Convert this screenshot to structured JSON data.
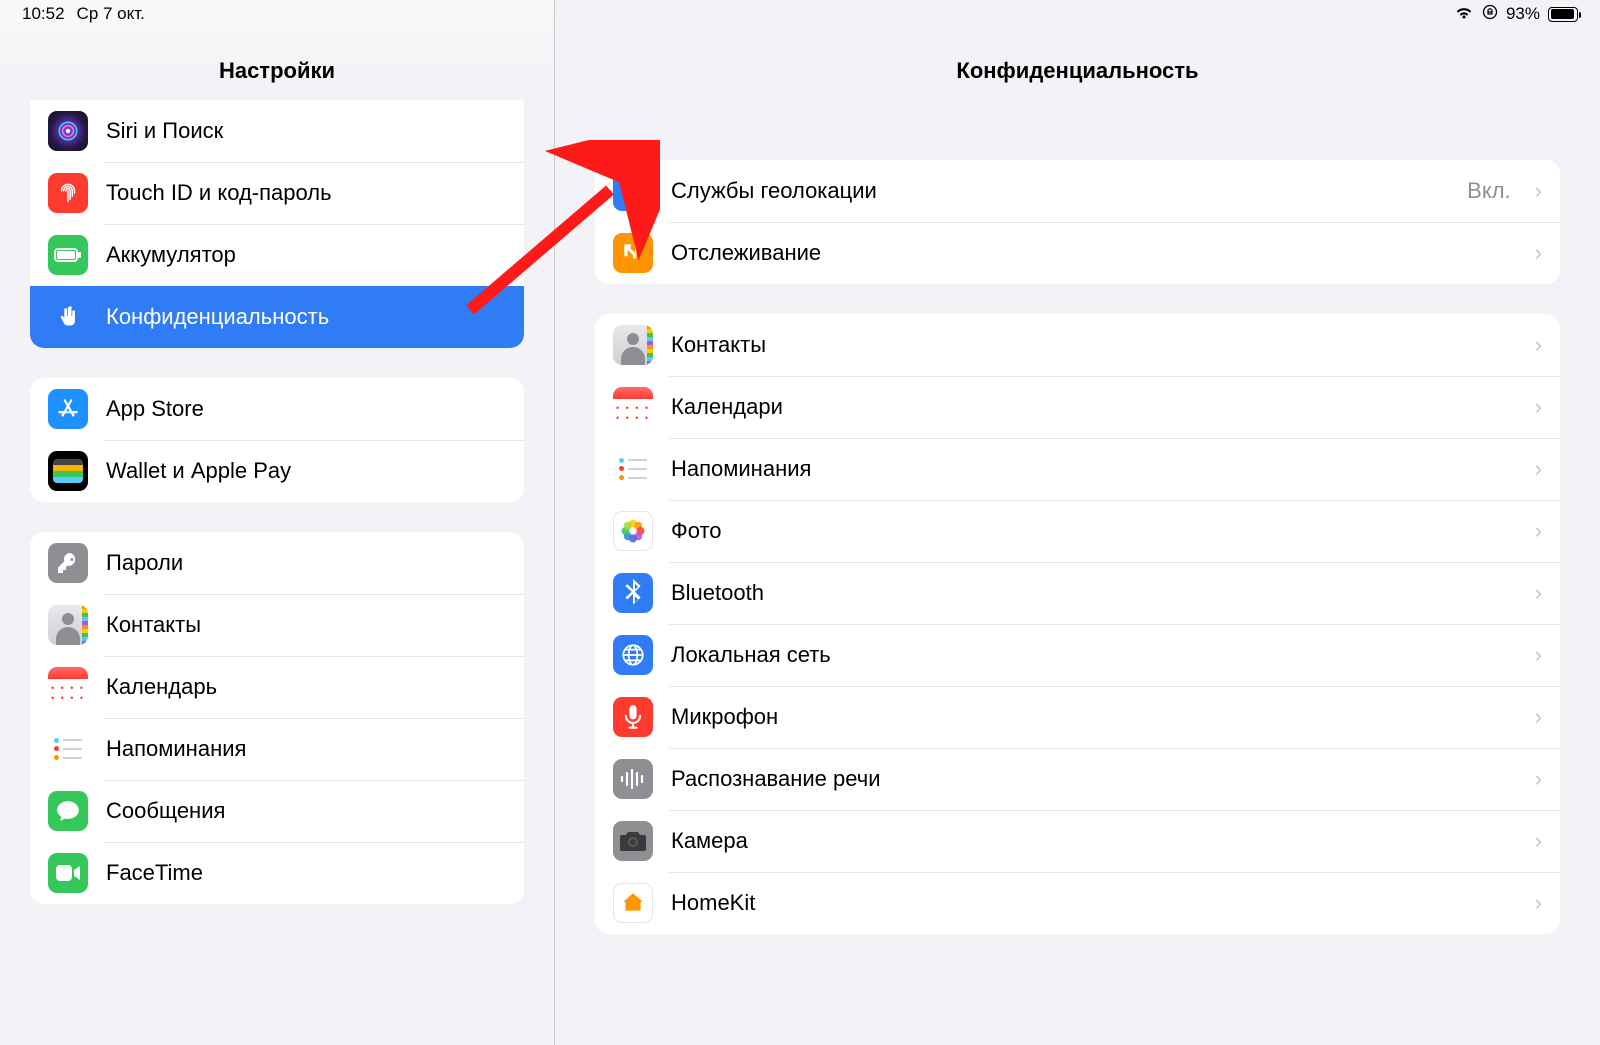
{
  "statusbar": {
    "time": "10:52",
    "date": "Ср 7 окт.",
    "battery_pct": "93%"
  },
  "sidebar": {
    "title": "Настройки",
    "groups": [
      {
        "items": [
          {
            "icon": "siri",
            "label": "Siri и Поиск"
          },
          {
            "icon": "touchid",
            "label": "Touch ID и код-пароль"
          },
          {
            "icon": "battery",
            "label": "Аккумулятор"
          },
          {
            "icon": "privacy",
            "label": "Конфиденциальность",
            "selected": true
          }
        ]
      },
      {
        "items": [
          {
            "icon": "appstore",
            "label": "App Store"
          },
          {
            "icon": "wallet",
            "label": "Wallet и Apple Pay"
          }
        ]
      },
      {
        "items": [
          {
            "icon": "passwords",
            "label": "Пароли"
          },
          {
            "icon": "contacts",
            "label": "Контакты"
          },
          {
            "icon": "calendar",
            "label": "Календарь"
          },
          {
            "icon": "reminders",
            "label": "Напоминания"
          },
          {
            "icon": "messages",
            "label": "Сообщения"
          },
          {
            "icon": "facetime",
            "label": "FaceTime"
          }
        ]
      }
    ]
  },
  "detail": {
    "title": "Конфиденциальность",
    "groups": [
      {
        "items": [
          {
            "icon": "location",
            "label": "Службы геолокации",
            "value": "Вкл."
          },
          {
            "icon": "tracking",
            "label": "Отслеживание"
          }
        ]
      },
      {
        "items": [
          {
            "icon": "contacts",
            "label": "Контакты"
          },
          {
            "icon": "calendar",
            "label": "Календари"
          },
          {
            "icon": "reminders",
            "label": "Напоминания"
          },
          {
            "icon": "photos",
            "label": "Фото"
          },
          {
            "icon": "bluetooth",
            "label": "Bluetooth"
          },
          {
            "icon": "localnet",
            "label": "Локальная сеть"
          },
          {
            "icon": "mic",
            "label": "Микрофон"
          },
          {
            "icon": "speech",
            "label": "Распознавание речи"
          },
          {
            "icon": "camera",
            "label": "Камера"
          },
          {
            "icon": "homekit",
            "label": "HomeKit"
          }
        ]
      }
    ]
  },
  "icons": {
    "siri": {
      "bg": "linear-gradient(135deg,#1a1a2e,#0f3460)",
      "glyph": "◉"
    },
    "touchid": {
      "bg": "#ff3b30",
      "glyph": "◎",
      "svg": "fingerprint"
    },
    "battery": {
      "bg": "#34c759",
      "glyph": "▬",
      "svg": "battery"
    },
    "privacy": {
      "bg": "#2f7cf6",
      "glyph": "✋",
      "svg": "hand"
    },
    "appstore": {
      "bg": "#1e90ff",
      "glyph": "A",
      "svg": "appstore"
    },
    "wallet": {
      "bg": "#000",
      "glyph": "💳",
      "svg": "wallet"
    },
    "passwords": {
      "bg": "#8e8e93",
      "glyph": "🔑",
      "svg": "key"
    },
    "contacts": {
      "bg": "linear-gradient(#d8d8dd,#bfbfc4)",
      "glyph": "👤",
      "svg": "contacts"
    },
    "calendar": {
      "bg": "#fff",
      "glyph": "📅",
      "svg": "calendar",
      "border": true
    },
    "reminders": {
      "bg": "#fff",
      "glyph": "⋮",
      "svg": "reminders",
      "border": true
    },
    "messages": {
      "bg": "#34c759",
      "glyph": "💬",
      "svg": "bubble"
    },
    "facetime": {
      "bg": "#34c759",
      "glyph": "📹",
      "svg": "facetime"
    },
    "location": {
      "bg": "#2f7cf6",
      "glyph": "➤",
      "svg": "location"
    },
    "tracking": {
      "bg": "#ff9500",
      "glyph": "↘",
      "svg": "tracking"
    },
    "photos": {
      "bg": "#fff",
      "glyph": "❋",
      "svg": "photos",
      "border": true
    },
    "bluetooth": {
      "bg": "#2f7cf6",
      "glyph": "ᚼ",
      "svg": "bluetooth"
    },
    "localnet": {
      "bg": "#2f7cf6",
      "glyph": "🌐",
      "svg": "globe"
    },
    "mic": {
      "bg": "#ff3b30",
      "glyph": "🎤",
      "svg": "mic"
    },
    "speech": {
      "bg": "#8e8e93",
      "glyph": "≡",
      "svg": "waveform"
    },
    "camera": {
      "bg": "#8e8e93",
      "glyph": "📷",
      "svg": "camera"
    },
    "homekit": {
      "bg": "#fff",
      "glyph": "🏠",
      "svg": "home",
      "border": true
    }
  }
}
